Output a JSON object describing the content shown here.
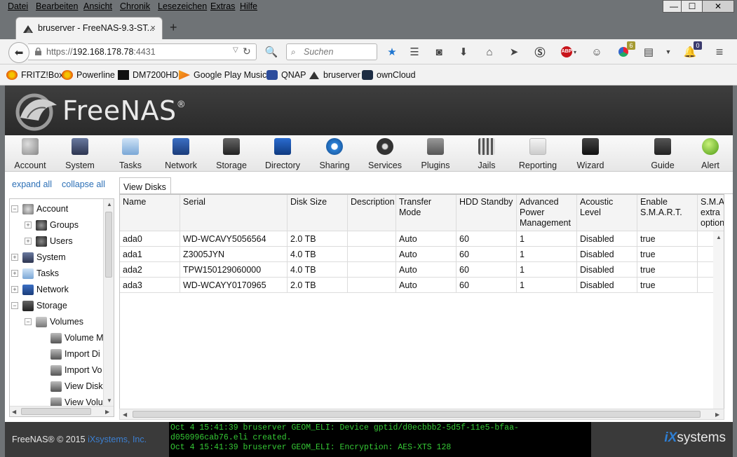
{
  "menubar": {
    "items": [
      "Datei",
      "Bearbeiten",
      "Ansicht",
      "Chronik",
      "Lesezeichen",
      "Extras",
      "Hilfe"
    ]
  },
  "window_controls": {
    "minimize": "—",
    "maximize": "☐",
    "close": "✕"
  },
  "browser_tab": {
    "title": "bruserver - FreeNAS-9.3-ST...",
    "close": "×",
    "new_tab": "+"
  },
  "address_bar": {
    "scheme": "https://",
    "host": "192.168.178.78",
    "port": ":4431"
  },
  "search": {
    "placeholder": "Suchen"
  },
  "toolbar_badges": {
    "extensions": "6",
    "notifications": "0"
  },
  "bookmarks": [
    "FRITZ!Box",
    "Powerline",
    "DM7200HD",
    "Google Play Music",
    "QNAP",
    "bruserver",
    "ownCloud"
  ],
  "app": {
    "name": "FreeNAS",
    "reg": "®"
  },
  "topnav": [
    {
      "label": "Account",
      "icon": "users-icon"
    },
    {
      "label": "System",
      "icon": "system-icon"
    },
    {
      "label": "Tasks",
      "icon": "calendar-icon"
    },
    {
      "label": "Network",
      "icon": "network-icon"
    },
    {
      "label": "Storage",
      "icon": "folder-icon"
    },
    {
      "label": "Directory",
      "icon": "directory-icon"
    },
    {
      "label": "Sharing",
      "icon": "sharing-icon"
    },
    {
      "label": "Services",
      "icon": "gears-icon"
    },
    {
      "label": "Plugins",
      "icon": "plugins-icon"
    },
    {
      "label": "Jails",
      "icon": "jails-icon"
    },
    {
      "label": "Reporting",
      "icon": "reporting-icon"
    },
    {
      "label": "Wizard",
      "icon": "wizard-icon"
    },
    {
      "label": "Guide",
      "icon": "guide-icon"
    },
    {
      "label": "Alert",
      "icon": "alert-light-icon"
    }
  ],
  "tree_controls": {
    "expand_all": "expand all",
    "collapse_all": "collapse all"
  },
  "tree": [
    {
      "label": "Account",
      "level": 0,
      "toggle": "−"
    },
    {
      "label": "Groups",
      "level": 1,
      "toggle": "+"
    },
    {
      "label": "Users",
      "level": 1,
      "toggle": "+"
    },
    {
      "label": "System",
      "level": 0,
      "toggle": "+"
    },
    {
      "label": "Tasks",
      "level": 0,
      "toggle": "+"
    },
    {
      "label": "Network",
      "level": 0,
      "toggle": "+"
    },
    {
      "label": "Storage",
      "level": 0,
      "toggle": "−"
    },
    {
      "label": "Volumes",
      "level": 1,
      "toggle": "−"
    },
    {
      "label": "Volume M",
      "level": 2,
      "toggle": ""
    },
    {
      "label": "Import Di",
      "level": 2,
      "toggle": ""
    },
    {
      "label": "Import Vo",
      "level": 2,
      "toggle": ""
    },
    {
      "label": "View Disk",
      "level": 2,
      "toggle": ""
    },
    {
      "label": "View Volu",
      "level": 2,
      "toggle": ""
    }
  ],
  "main": {
    "tab_label": "View Disks",
    "columns": [
      "Name",
      "Serial",
      "Disk Size",
      "Description",
      "Transfer Mode",
      "HDD Standby",
      "Advanced Power Management",
      "Acoustic Level",
      "Enable S.M.A.R.T.",
      "S.M.A. extra option"
    ],
    "rows": [
      [
        "ada0",
        "WD-WCAVY5056564",
        "2.0 TB",
        "",
        "Auto",
        "60",
        "1",
        "Disabled",
        "true",
        ""
      ],
      [
        "ada1",
        "Z3005JYN",
        "4.0 TB",
        "",
        "Auto",
        "60",
        "1",
        "Disabled",
        "true",
        ""
      ],
      [
        "ada2",
        "TPW150129060000",
        "4.0 TB",
        "",
        "Auto",
        "60",
        "1",
        "Disabled",
        "true",
        ""
      ],
      [
        "ada3",
        "WD-WCAYY0170965",
        "2.0 TB",
        "",
        "Auto",
        "60",
        "1",
        "Disabled",
        "true",
        ""
      ]
    ]
  },
  "footer": {
    "copyright": "FreeNAS® © 2015",
    "company": "iXsystems, Inc.",
    "console": [
      "Oct  4 15:41:39 bruserver GEOM_ELI: Device gptid/d0ecbbb2-5d5f-11e5-bfaa-",
      "d050996cab76.eli created.",
      "Oct  4 15:41:39 bruserver GEOM_ELI: Encryption: AES-XTS 128"
    ],
    "brand_ix": "iX",
    "brand_rest": "systems"
  },
  "colors": {
    "link": "#2b6fb6",
    "console_text": "#35c935",
    "header_bg": "#333333",
    "chrome_bg": "#6f7376"
  }
}
